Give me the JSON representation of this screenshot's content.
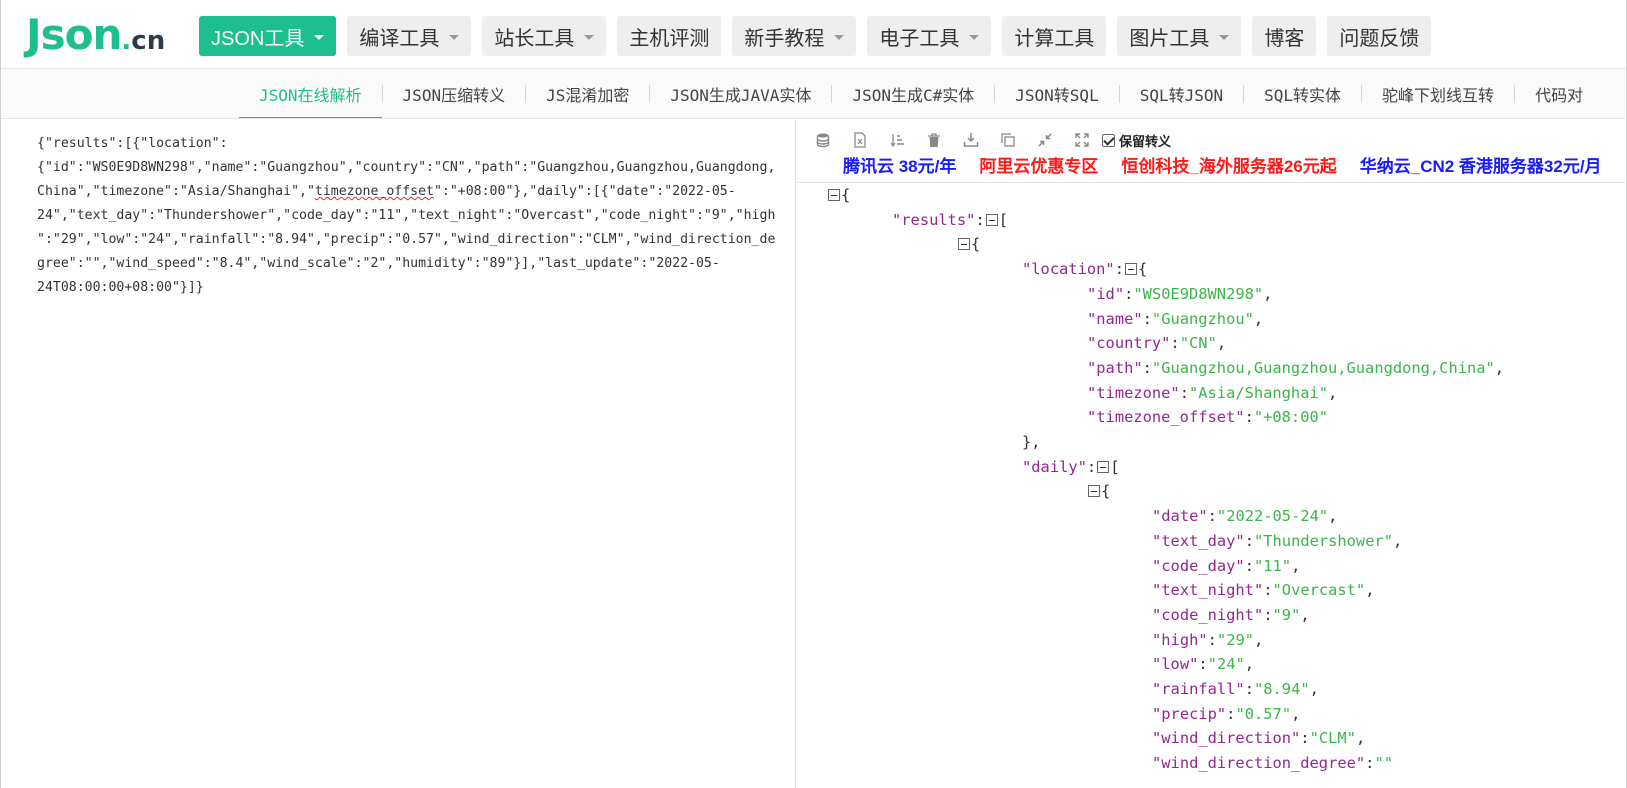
{
  "logo": {
    "main": "Json",
    "dot": ".",
    "suffix": "cn"
  },
  "nav": {
    "items": [
      {
        "label": "JSON工具",
        "dropdown": true,
        "active": true
      },
      {
        "label": "编译工具",
        "dropdown": true
      },
      {
        "label": "站长工具",
        "dropdown": true
      },
      {
        "label": "主机评测",
        "dropdown": false
      },
      {
        "label": "新手教程",
        "dropdown": true
      },
      {
        "label": "电子工具",
        "dropdown": true
      },
      {
        "label": "计算工具",
        "dropdown": false
      },
      {
        "label": "图片工具",
        "dropdown": true
      },
      {
        "label": "博客",
        "dropdown": false
      },
      {
        "label": "问题反馈",
        "dropdown": false
      }
    ]
  },
  "subnav": {
    "items": [
      "JSON在线解析",
      "JSON压缩转义",
      "JS混淆加密",
      "JSON生成JAVA实体",
      "JSON生成C#实体",
      "JSON转SQL",
      "SQL转JSON",
      "SQL转实体",
      "驼峰下划线互转",
      "代码对"
    ],
    "active_index": 0
  },
  "editor": {
    "raw_before": "{\"results\":[{\"location\":\n{\"id\":\"WS0E9D8WN298\",\"name\":\"Guangzhou\",\"country\":\"CN\",\"path\":\"Guangzhou,Guangzhou,Guangdong,\nChina\",\"timezone\":\"Asia/Shanghai\",\"",
    "raw_highlight": "timezone_offset",
    "raw_after": "\":\"+08:00\"},\"daily\":[{\"date\":\"2022-05-\n24\",\"text_day\":\"Thundershower\",\"code_day\":\"11\",\"text_night\":\"Overcast\",\"code_night\":\"9\",\"high\n\":\"29\",\"low\":\"24\",\"rainfall\":\"8.94\",\"precip\":\"0.57\",\"wind_direction\":\"CLM\",\"wind_direction_de\ngree\":\"\",\"wind_speed\":\"8.4\",\"wind_scale\":\"2\",\"humidity\":\"89\"}],\"last_update\":\"2022-05-\n24T08:00:00+08:00\"}]}"
  },
  "toolbar": {
    "icons": [
      "database-icon",
      "excel-icon",
      "sort-icon",
      "trash-icon",
      "download-icon",
      "copy-icon",
      "compress-icon",
      "expand-icon"
    ],
    "keep_escape_label": "保留转义",
    "keep_escape_checked": true
  },
  "ads": [
    {
      "label": "腾讯云 38元/年",
      "color": "#1a1aff"
    },
    {
      "label": "阿里云优惠专区",
      "color": "#ff1a1a"
    },
    {
      "label": "恒创科技_海外服务器26元起",
      "color": "#ff1a1a"
    },
    {
      "label": "华纳云_CN2 香港服务器32元/月",
      "color": "#1a1aff"
    }
  ],
  "tree": {
    "results_key": "results",
    "location_key": "location",
    "location": [
      {
        "key": "id",
        "value": "WS0E9D8WN298"
      },
      {
        "key": "name",
        "value": "Guangzhou"
      },
      {
        "key": "country",
        "value": "CN"
      },
      {
        "key": "path",
        "value": "Guangzhou,Guangzhou,Guangdong,China"
      },
      {
        "key": "timezone",
        "value": "Asia/Shanghai"
      },
      {
        "key": "timezone_offset",
        "value": "+08:00"
      }
    ],
    "daily_key": "daily",
    "daily": [
      {
        "key": "date",
        "value": "2022-05-24"
      },
      {
        "key": "text_day",
        "value": "Thundershower"
      },
      {
        "key": "code_day",
        "value": "11"
      },
      {
        "key": "text_night",
        "value": "Overcast"
      },
      {
        "key": "code_night",
        "value": "9"
      },
      {
        "key": "high",
        "value": "29"
      },
      {
        "key": "low",
        "value": "24"
      },
      {
        "key": "rainfall",
        "value": "8.94"
      },
      {
        "key": "precip",
        "value": "0.57"
      },
      {
        "key": "wind_direction",
        "value": "CLM"
      },
      {
        "key": "wind_direction_degree",
        "value": ""
      }
    ]
  },
  "colors": {
    "accent": "#1cbf8d",
    "json_key": "#92278f",
    "json_string": "#3ab54a"
  }
}
